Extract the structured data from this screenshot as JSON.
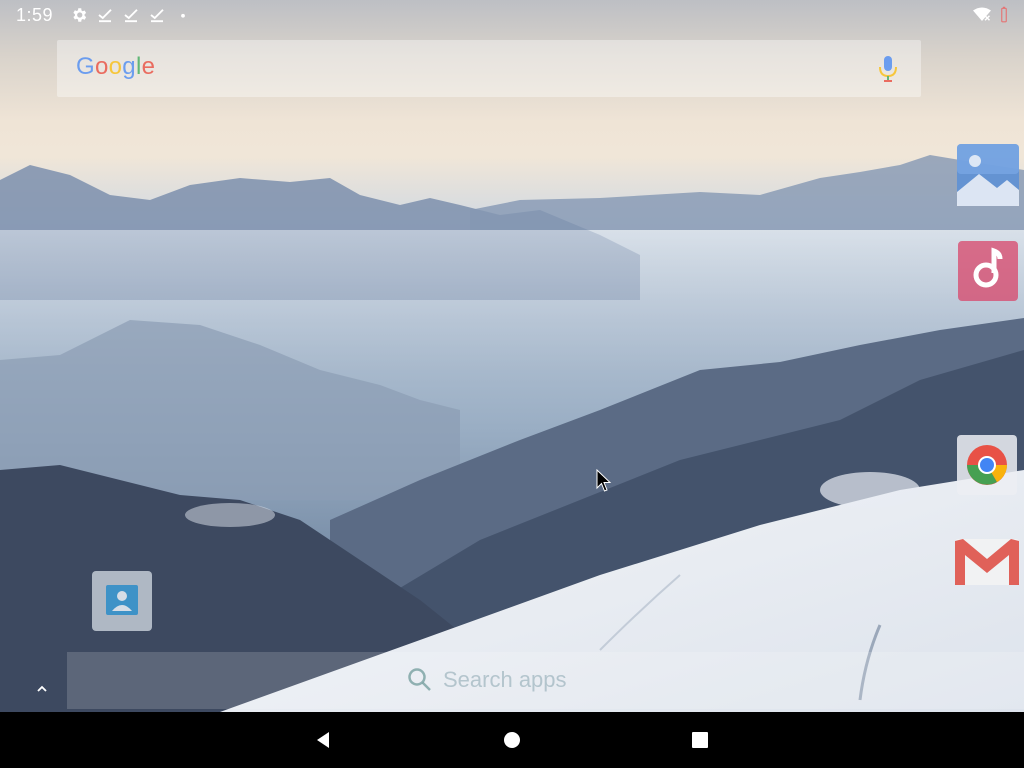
{
  "status_bar": {
    "time": "1:59",
    "icons": [
      "settings-icon",
      "download-done-icon",
      "download-done-icon",
      "download-done-icon",
      "dot-icon"
    ],
    "right_icons": [
      "wifi-off-icon",
      "battery-empty-icon"
    ]
  },
  "search_widget": {
    "logo_letters": [
      "G",
      "o",
      "o",
      "g",
      "l",
      "e"
    ],
    "logo_colors": [
      "#4285F4",
      "#EA4335",
      "#FBBC05",
      "#4285F4",
      "#34A853",
      "#EA4335"
    ],
    "mic_icon": "mic-icon"
  },
  "dock_apps": [
    {
      "name": "Gallery",
      "icon": "gallery-icon",
      "color": "#4f8ad6"
    },
    {
      "name": "Music",
      "icon": "music-icon",
      "color": "#d8456a"
    },
    {
      "name": "Chrome",
      "icon": "chrome-icon",
      "color": "#e0e0e0"
    },
    {
      "name": "Gmail",
      "icon": "gmail-icon",
      "color": "#d93025"
    }
  ],
  "home_apps": [
    {
      "name": "Contacts",
      "icon": "contacts-icon",
      "color": "#1e88c8"
    }
  ],
  "apps_search": {
    "placeholder": "Search apps",
    "expand_icon": "chevron-up-icon"
  },
  "nav_bar": {
    "buttons": [
      "back-button",
      "home-button",
      "recents-button"
    ]
  }
}
